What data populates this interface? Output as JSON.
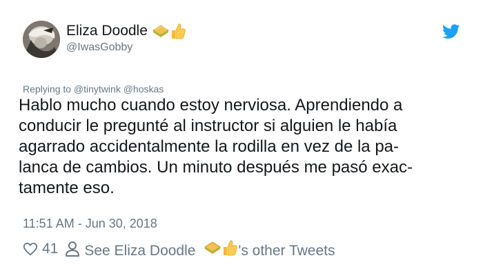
{
  "user": {
    "display_name": "Eliza Doodle",
    "handle": "@IwasGobby"
  },
  "icons": {
    "avatar": "profile-avatar",
    "name_emojis": [
      "sandwich-emoji",
      "thumbs-up-emoji"
    ],
    "brand": "twitter-bird-icon",
    "like": "heart-icon",
    "profile": "person-icon"
  },
  "colors": {
    "text": "#14171a",
    "muted": "#657786",
    "twitter_blue": "#1da1f2"
  },
  "reply": {
    "text": "Replying to @tinytwink @hoskas"
  },
  "tweet": {
    "text": "Hablo mucho cuando estoy nerviosa. Aprendiendo a\nconducir le pregunté al instructor si alguien le había\nagarrado accidentalmente la rodilla en vez de la pa-\nlanca de cambios. Un minuto después me pasó exac-\ntamente eso.",
    "timestamp": "11:51 AM - Jun 30, 2018"
  },
  "actions": {
    "like_count": "41",
    "see_prefix": "See Eliza Doodle",
    "see_suffix": "'s other Tweets"
  }
}
